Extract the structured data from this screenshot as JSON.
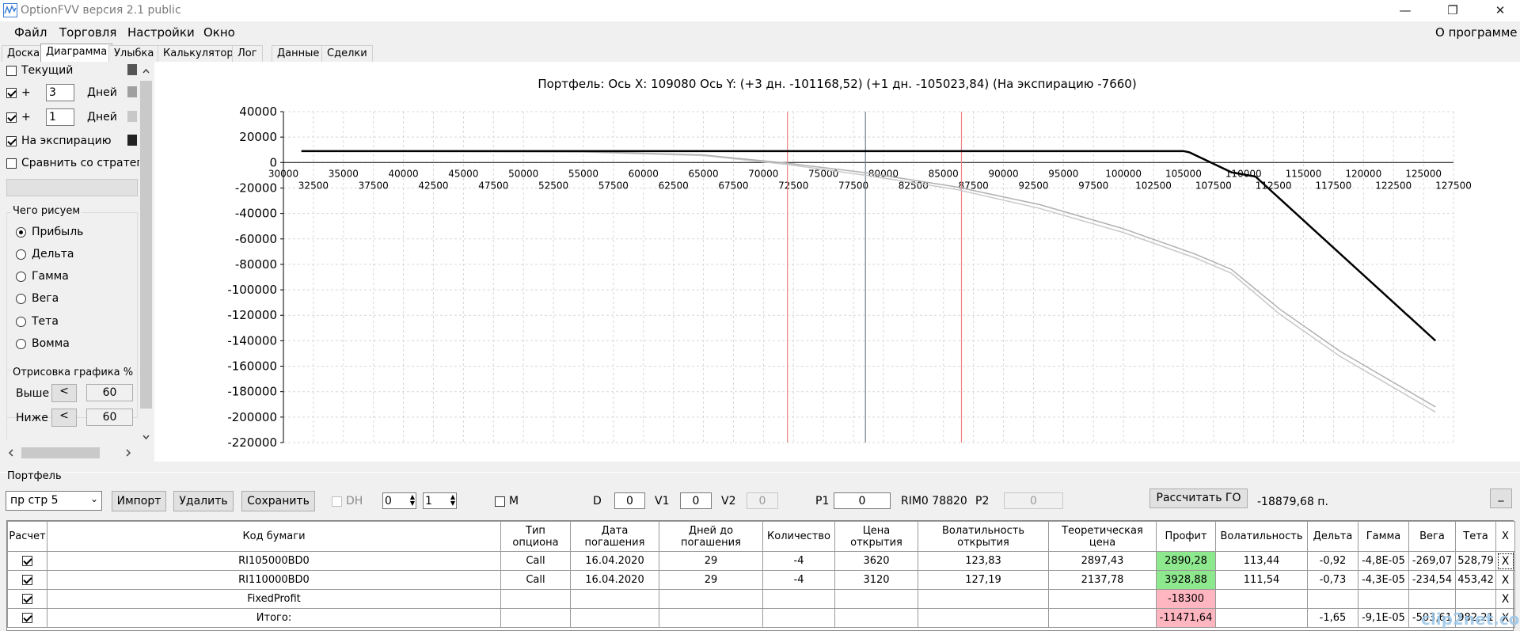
{
  "app": {
    "title": "OptionFVV версия 2.1 public"
  },
  "menu": {
    "items": [
      "Файл",
      "Торговля",
      "Настройки",
      "Окно"
    ],
    "about": "О программе"
  },
  "tabs": [
    "Доска",
    "Диаграмма",
    "Улыбка",
    "Калькулятор",
    "Лог",
    "Данные",
    "Сделки"
  ],
  "left": {
    "current_label": "Текущий",
    "plus_label": "+",
    "days1_value": "3",
    "days2_value": "1",
    "days_label": "Дней",
    "expiry_label": "На экспирацию",
    "compare_label": "Сравнить со стратегие",
    "what_title": "Чего рисуем",
    "radios": [
      "Прибыль",
      "Дельта",
      "Гамма",
      "Вега",
      "Тета",
      "Вомма"
    ],
    "draw_title": "Отрисовка графика %",
    "above_label": "Выше",
    "below_label": "Ниже",
    "btn_lt": "<",
    "above_value": "60",
    "below_value": "60",
    "swatch_colors": [
      "#555555",
      "#a0a0a0",
      "#c8c8c8",
      "#222222"
    ]
  },
  "chart_data": {
    "type": "line",
    "title": "Портфель: Ось X: 109080 Ось Y:  (+3 дн. -101168,52)  (+1 дн. -105023,84)  (На экспирацию -7660)",
    "xlim": [
      30000,
      127500
    ],
    "ylim": [
      -220000,
      40000
    ],
    "x_ticks_upper": [
      30000,
      35000,
      40000,
      45000,
      50000,
      55000,
      60000,
      65000,
      70000,
      75000,
      80000,
      85000,
      90000,
      95000,
      100000,
      105000,
      110000,
      115000,
      120000,
      125000
    ],
    "x_ticks_lower": [
      32500,
      37500,
      42500,
      47500,
      52500,
      57500,
      62500,
      67500,
      72500,
      77500,
      82500,
      87500,
      92500,
      97500,
      102500,
      107500,
      112500,
      117500,
      122500,
      127500
    ],
    "y_ticks": [
      40000,
      20000,
      0,
      -20000,
      -40000,
      -60000,
      -80000,
      -100000,
      -120000,
      -140000,
      -160000,
      -180000,
      -200000,
      -220000
    ],
    "vlines": [
      {
        "x": 72000,
        "color": "#f08080"
      },
      {
        "x": 78500,
        "color": "#708090"
      },
      {
        "x": 86500,
        "color": "#f08080"
      }
    ],
    "series": [
      {
        "color": "#000000",
        "x": [
          31500,
          105000,
          105500,
          109000,
          111000,
          126000
        ],
        "y": [
          9000,
          9000,
          8000,
          -7660,
          -11000,
          -140000
        ]
      },
      {
        "color": "#b0b0b0",
        "x": [
          31500,
          55000,
          65000,
          72000,
          78500,
          86000,
          93000,
          100000,
          106000,
          109000,
          113000,
          118000,
          122000,
          126000
        ],
        "y": [
          9000,
          8500,
          6000,
          -500,
          -8000,
          -19000,
          -33000,
          -52000,
          -72000,
          -84000,
          -115000,
          -148000,
          -170000,
          -192000
        ]
      },
      {
        "color": "#c8c8c8",
        "x": [
          31500,
          55000,
          65000,
          72000,
          78500,
          86000,
          93000,
          100000,
          106000,
          109000,
          113000,
          118000,
          122000,
          126000
        ],
        "y": [
          9000,
          8300,
          5500,
          -1500,
          -10000,
          -21000,
          -36000,
          -55000,
          -75000,
          -87000,
          -119000,
          -152000,
          -174000,
          -196000
        ]
      }
    ]
  },
  "portfolio": {
    "title": "Портфель",
    "selected": "пр стр 5",
    "import_label": "Импорт",
    "delete_label": "Удалить",
    "save_label": "Сохранить",
    "dh_label": "DH",
    "spin1": "0",
    "spin2": "1",
    "m_label": "M",
    "d_label": "D",
    "d_value": "0",
    "v1_label": "V1",
    "v1_value": "0",
    "v2_label": "V2",
    "v2_value": "0",
    "p1_label": "P1",
    "p1_value": "0",
    "rim": "RIM0 78820",
    "p2_label": "P2",
    "p2_value": "0",
    "calc_go_label": "Рассчитать ГО",
    "go_value": "-18879,68 п.",
    "min_label": "_"
  },
  "table": {
    "columns": [
      "Расчет",
      "Код бумаги",
      "Тип опциона",
      "Дата погашения",
      "Дней до погашения",
      "Количество",
      "Цена открытия",
      "Волатильность открытия",
      "Теоретическая цена",
      "Профит",
      "Волатильность",
      "Дельта",
      "Гамма",
      "Вега",
      "Тета",
      "X"
    ],
    "rows": [
      {
        "code": "RI105000BD0",
        "type": "Call",
        "date": "16.04.2020",
        "days": "29",
        "qty": "-4",
        "open": "3620",
        "vol_open": "123,83",
        "theo": "2897,43",
        "profit": "2890,28",
        "vol": "113,44",
        "delta": "-0,92",
        "gamma": "-4,8E-05",
        "vega": "-269,07",
        "theta": "528,79",
        "x": "X"
      },
      {
        "code": "RI110000BD0",
        "type": "Call",
        "date": "16.04.2020",
        "days": "29",
        "qty": "-4",
        "open": "3120",
        "vol_open": "127,19",
        "theo": "2137,78",
        "profit": "3928,88",
        "vol": "111,54",
        "delta": "-0,73",
        "gamma": "-4,3E-05",
        "vega": "-234,54",
        "theta": "453,42",
        "x": "X"
      },
      {
        "code": "FixedProfit",
        "profit": "-18300",
        "x": "X"
      },
      {
        "code": "Итого:",
        "profit": "-11471,64",
        "delta": "-1,65",
        "gamma": "-9,1E-05",
        "vega": "-503,61",
        "theta": "982,21",
        "x": "X"
      }
    ]
  },
  "watermark": "clip2net.com"
}
